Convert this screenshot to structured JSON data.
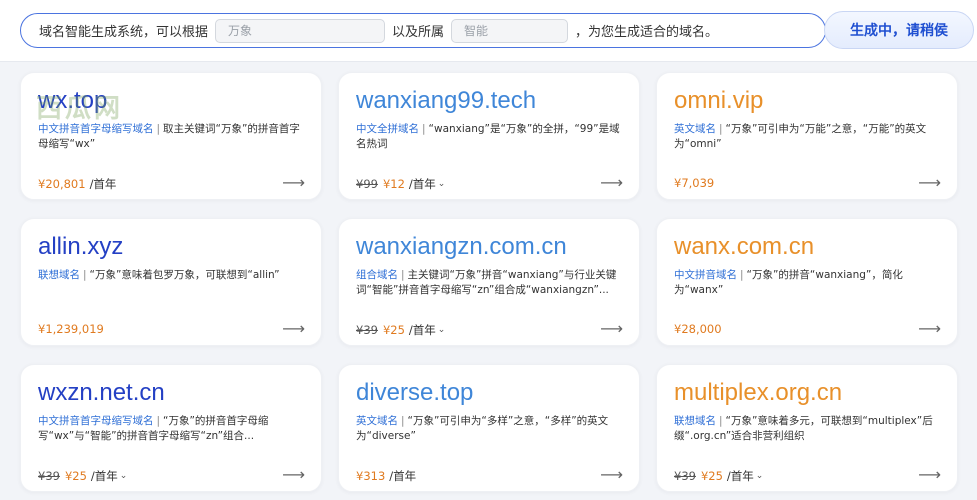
{
  "prompt": {
    "part1": "域名智能生成系统，可以根据",
    "field1_placeholder": "万象",
    "part2": "以及所属",
    "field2_placeholder": "智能",
    "part3": "，为您生成适合的域名。",
    "generate_button": "生成中，请稍侯"
  },
  "watermark": "西瓜网",
  "cards": [
    {
      "domain": "wx.top",
      "color": "#2440c4",
      "tag": "中文拼音首字母缩写域名",
      "desc": "取主关键词“万象”的拼音首字母缩写“wx”",
      "old_price": "",
      "price": "¥20,801",
      "unit": "/首年",
      "has_caret": false
    },
    {
      "domain": "wanxiang99.tech",
      "color": "#3f86d8",
      "tag": "中文全拼域名",
      "desc": "“wanxiang”是“万象”的全拼，“99”是域名热词",
      "old_price": "¥99",
      "price": "¥12",
      "unit": "/首年",
      "has_caret": true
    },
    {
      "domain": "omni.vip",
      "color": "#e8902a",
      "tag": "英文域名",
      "desc": "“万象”可引申为“万能”之意，“万能”的英文为“omni”",
      "old_price": "",
      "price": "¥7,039",
      "unit": "",
      "has_caret": false
    },
    {
      "domain": "allin.xyz",
      "color": "#2440c4",
      "tag": "联想域名",
      "desc": "“万象”意味着包罗万象，可联想到“allin”",
      "old_price": "",
      "price": "¥1,239,019",
      "unit": "",
      "has_caret": false
    },
    {
      "domain": "wanxiangzn.com.cn",
      "color": "#3f86d8",
      "tag": "组合域名",
      "desc": "主关键词“万象”拼音“wanxiang”与行业关键词“智能”拼音首字母缩写“zn”组合成“wanxiangzn”...",
      "old_price": "¥39",
      "price": "¥25",
      "unit": "/首年",
      "has_caret": true
    },
    {
      "domain": "wanx.com.cn",
      "color": "#e8902a",
      "tag": "中文拼音域名",
      "desc": "“万象”的拼音“wanxiang”，简化为“wanx”",
      "old_price": "",
      "price": "¥28,000",
      "unit": "",
      "has_caret": false
    },
    {
      "domain": "wxzn.net.cn",
      "color": "#2440c4",
      "tag": "中文拼音首字母缩写域名",
      "desc": "“万象”的拼音首字母缩写“wx”与“智能”的拼音首字母缩写“zn”组合...",
      "old_price": "¥39",
      "price": "¥25",
      "unit": "/首年",
      "has_caret": true
    },
    {
      "domain": "diverse.top",
      "color": "#3f86d8",
      "tag": "英文域名",
      "desc": "“万象”可引申为“多样”之意，“多样”的英文为“diverse”",
      "old_price": "",
      "price": "¥313",
      "unit": "/首年",
      "has_caret": false
    },
    {
      "domain": "multiplex.org.cn",
      "color": "#e8902a",
      "tag": "联想域名",
      "desc": "“万象”意味着多元，可联想到“multiplex”后缀“.org.cn”适合非营利组织",
      "old_price": "¥39",
      "price": "¥25",
      "unit": "/首年",
      "has_caret": true
    }
  ],
  "icons": {
    "arrow": "arrow-right-icon",
    "caret": "chevron-down-icon"
  }
}
